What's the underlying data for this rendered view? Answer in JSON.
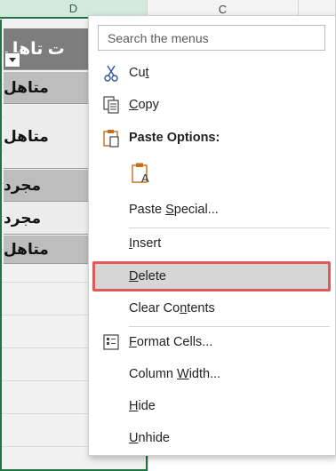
{
  "sheet": {
    "column_headers": [
      "D",
      "C"
    ],
    "rows": [
      "ت تاهل",
      "متاهل",
      "متاهل",
      "مجرد",
      "مجرد",
      "متاهل"
    ]
  },
  "context_menu": {
    "search_placeholder": "Search the menus",
    "items": {
      "cut": {
        "before": "Cu",
        "mnemonic": "t",
        "after": ""
      },
      "copy": {
        "before": "",
        "mnemonic": "C",
        "after": "opy"
      },
      "paste_options": {
        "label": "Paste Options:"
      },
      "paste_special": {
        "before": "Paste ",
        "mnemonic": "S",
        "after": "pecial..."
      },
      "insert": {
        "before": "",
        "mnemonic": "I",
        "after": "nsert"
      },
      "delete": {
        "before": "",
        "mnemonic": "D",
        "after": "elete"
      },
      "clear_contents": {
        "before": "Clear Co",
        "mnemonic": "n",
        "after": "tents"
      },
      "format_cells": {
        "before": "",
        "mnemonic": "F",
        "after": "ormat Cells..."
      },
      "column_width": {
        "before": "Column ",
        "mnemonic": "W",
        "after": "idth..."
      },
      "hide": {
        "before": "",
        "mnemonic": "H",
        "after": "ide"
      },
      "unhide": {
        "before": "",
        "mnemonic": "U",
        "after": "nhide"
      }
    }
  },
  "colors": {
    "selection_green": "#217346",
    "highlight_border": "#e05a5a",
    "highlight_fill": "#d6d6d6"
  },
  "icons": [
    "scissors-icon",
    "copy-icon",
    "clipboard-icon",
    "paste-text-icon",
    "format-cells-icon",
    "filter-dropdown-icon"
  ]
}
